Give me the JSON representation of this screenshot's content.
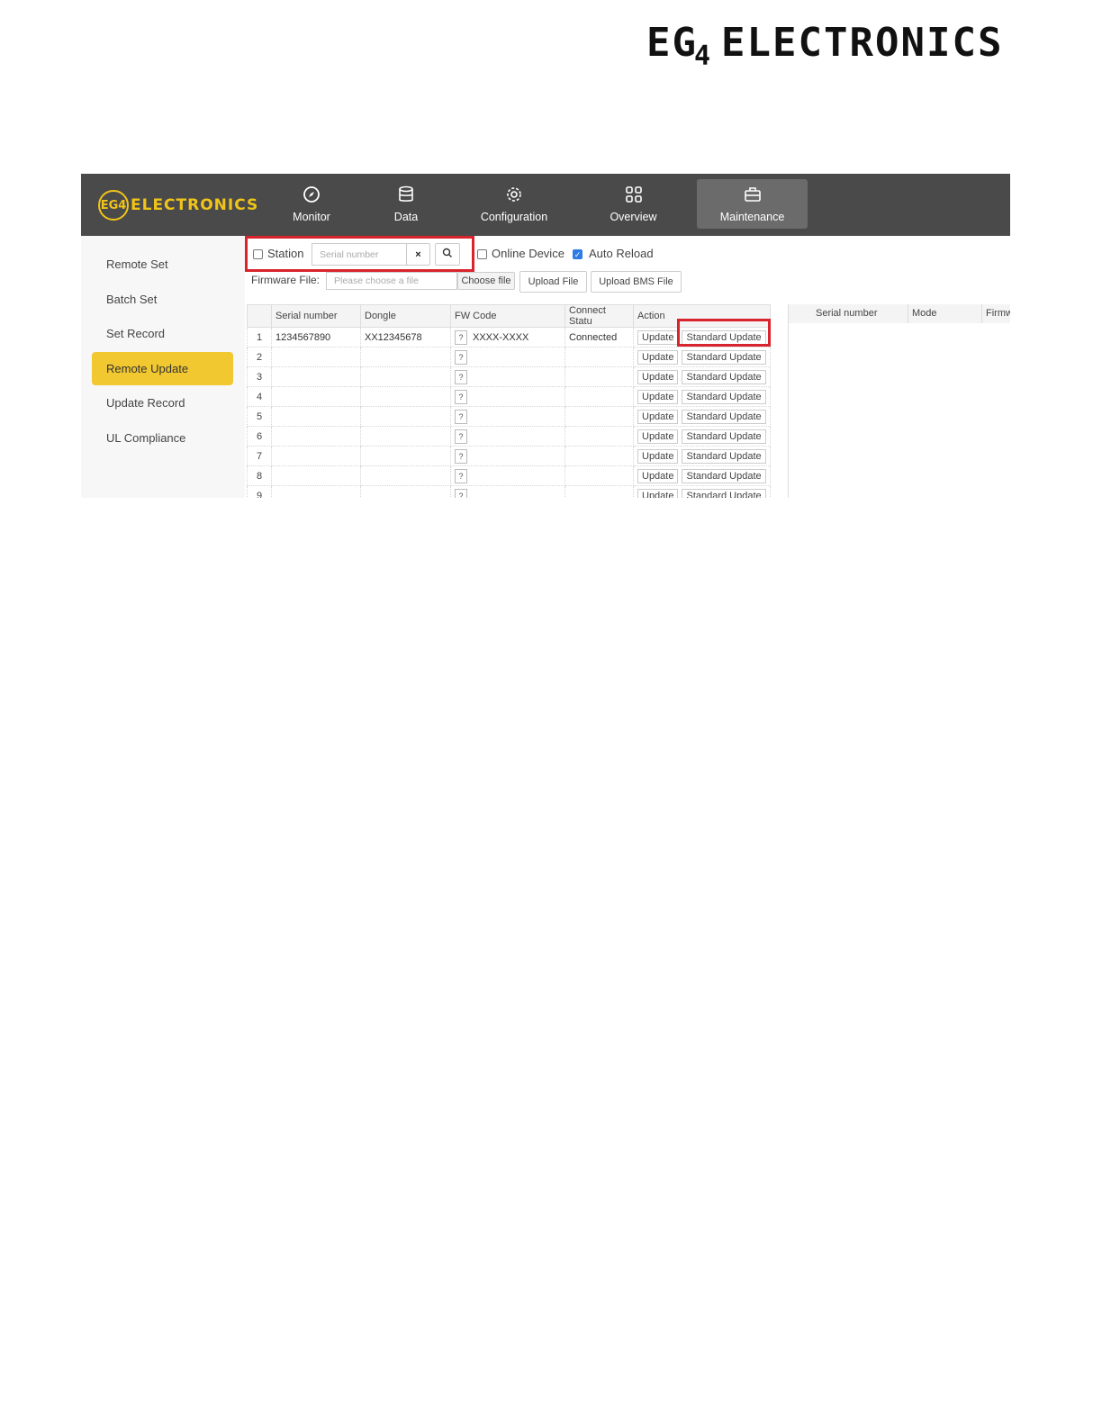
{
  "page_logo": {
    "part1": "EG",
    "part2": "4",
    "part3": "ELECTRONICS"
  },
  "app": {
    "brand": {
      "circle": "EG4",
      "text": "ELECTRONICS"
    },
    "nav": [
      {
        "label": "Monitor",
        "icon": "compass-icon"
      },
      {
        "label": "Data",
        "icon": "database-icon"
      },
      {
        "label": "Configuration",
        "icon": "gear-icon"
      },
      {
        "label": "Overview",
        "icon": "grid-icon"
      },
      {
        "label": "Maintenance",
        "icon": "toolbox-icon",
        "active": true
      }
    ],
    "sidebar": [
      {
        "label": "Remote Set"
      },
      {
        "label": "Batch Set"
      },
      {
        "label": "Set Record"
      },
      {
        "label": "Remote Update",
        "active": true
      },
      {
        "label": "Update Record"
      },
      {
        "label": "UL Compliance"
      }
    ],
    "toolbar": {
      "station_label": "Station",
      "serial_placeholder": "Serial number",
      "clear_symbol": "×",
      "online_device_label": "Online Device",
      "auto_reload_label": "Auto Reload",
      "firmware_file_label": "Firmware File:",
      "file_placeholder": "Please choose a file",
      "choose_file": "Choose file",
      "upload_file": "Upload File",
      "upload_bms_file": "Upload BMS File"
    },
    "table": {
      "headers": [
        "Serial number",
        "Dongle",
        "FW Code",
        "Connect Statu",
        "Action"
      ],
      "rows": [
        {
          "n": "1",
          "serial": "1234567890",
          "dongle": "XX12345678",
          "fw": "XXXX-XXXX",
          "status": "Connected"
        },
        {
          "n": "2",
          "serial": "",
          "dongle": "",
          "fw": "",
          "status": ""
        },
        {
          "n": "3",
          "serial": "",
          "dongle": "",
          "fw": "",
          "status": ""
        },
        {
          "n": "4",
          "serial": "",
          "dongle": "",
          "fw": "",
          "status": ""
        },
        {
          "n": "5",
          "serial": "",
          "dongle": "",
          "fw": "",
          "status": ""
        },
        {
          "n": "6",
          "serial": "",
          "dongle": "",
          "fw": "",
          "status": ""
        },
        {
          "n": "7",
          "serial": "",
          "dongle": "",
          "fw": "",
          "status": ""
        },
        {
          "n": "8",
          "serial": "",
          "dongle": "",
          "fw": "",
          "status": ""
        },
        {
          "n": "9",
          "serial": "",
          "dongle": "",
          "fw": "",
          "status": ""
        }
      ],
      "fw_question": "?",
      "update_label": "Update",
      "standard_update_label": "Standard Update"
    },
    "right_table": {
      "headers": [
        "Serial number",
        "Mode",
        "Firmw"
      ]
    }
  }
}
